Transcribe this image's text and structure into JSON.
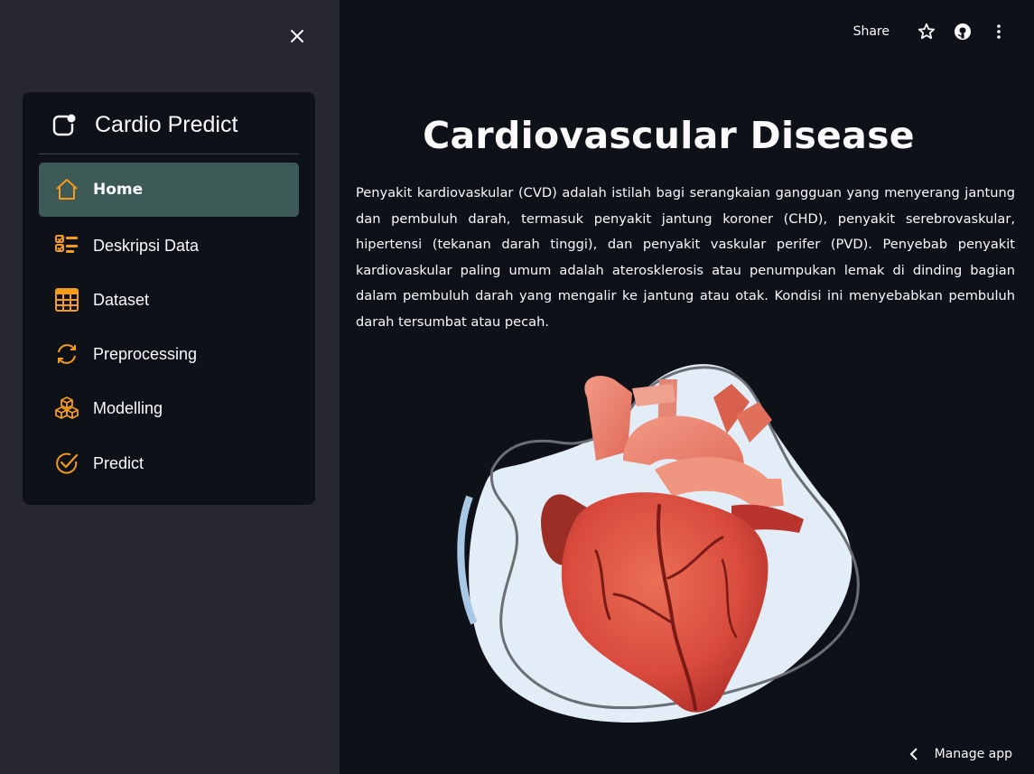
{
  "sidebar": {
    "close_icon": "close-icon",
    "menu": {
      "title": "Cardio Predict",
      "title_icon": "app-icon",
      "accent_color": "#f59b1b",
      "active_bg": "#3e5a57",
      "items": [
        {
          "label": "Home",
          "icon": "house-icon",
          "active": true
        },
        {
          "label": "Deskripsi Data",
          "icon": "checklist-icon",
          "active": false
        },
        {
          "label": "Dataset",
          "icon": "table-icon",
          "active": false
        },
        {
          "label": "Preprocessing",
          "icon": "refresh-icon",
          "active": false
        },
        {
          "label": "Modelling",
          "icon": "boxes-icon",
          "active": false
        },
        {
          "label": "Predict",
          "icon": "check-circle-icon",
          "active": false
        }
      ]
    }
  },
  "header": {
    "share_label": "Share",
    "icons": [
      "star-icon",
      "github-icon",
      "more-vertical-icon"
    ]
  },
  "main": {
    "title": "Cardiovascular Disease",
    "description": "Penyakit kardiovaskular (CVD) adalah istilah bagi serangkaian gangguan yang menyerang jantung dan pembuluh darah, termasuk penyakit jantung koroner (CHD), penyakit serebrovaskular, hipertensi (tekanan darah tinggi), dan penyakit vaskular perifer (PVD). Penyebab penyakit kardiovaskular paling umum adalah aterosklerosis atau penumpukan lemak di dinding bagian dalam pembuluh darah yang mengalir ke jantung atau otak. Kondisi ini menyebabkan pembuluh darah tersumbat atau pecah.",
    "illustration": "heart-illustration"
  },
  "footer": {
    "manage_app_label": "Manage app"
  }
}
